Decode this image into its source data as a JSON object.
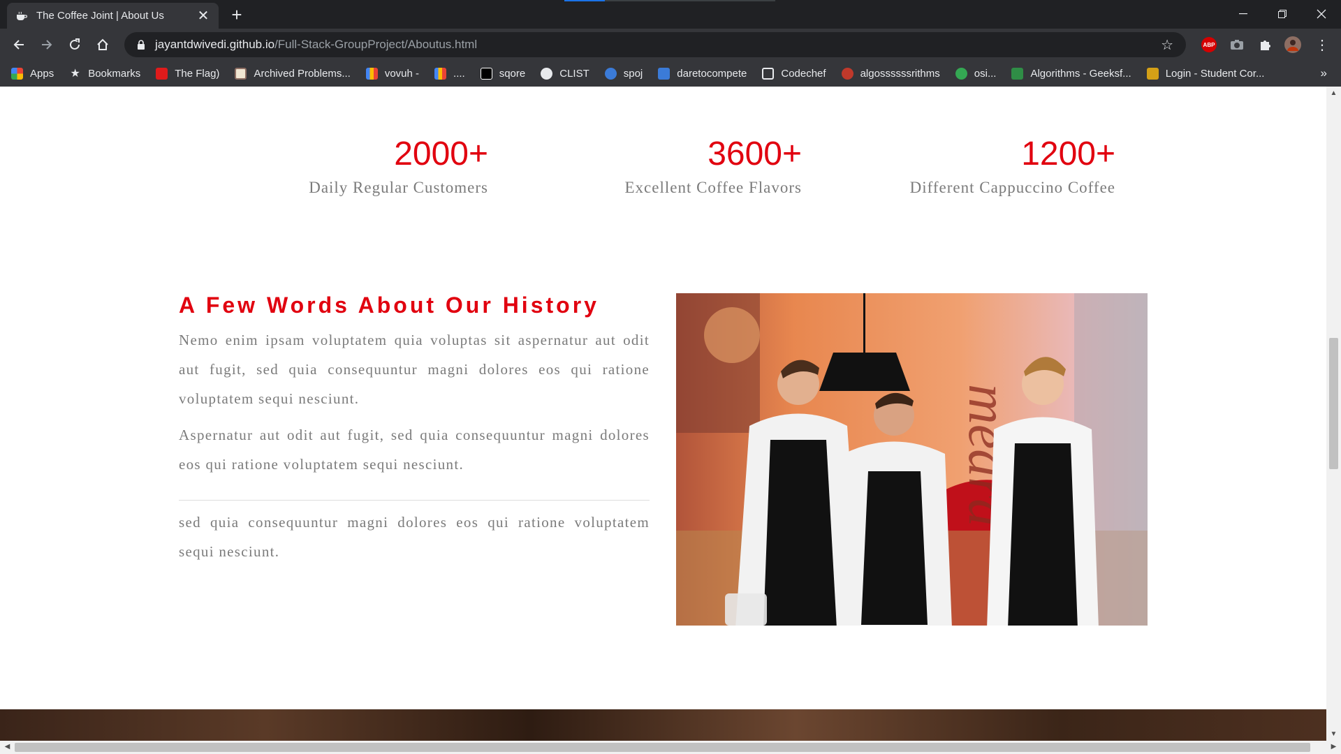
{
  "browser": {
    "tab_title": "The Coffee Joint | About Us",
    "url_host": "jayantdwivedi.github.io",
    "url_path": "/Full-Stack-GroupProject/Aboutus.html",
    "extension_abp_label": "ABP"
  },
  "bookmarks": [
    {
      "label": "Apps",
      "color": "#ea4335"
    },
    {
      "label": "Bookmarks",
      "color": "#e8eaed"
    },
    {
      "label": "The Flag)",
      "color": "#e01b1b"
    },
    {
      "label": "Archived Problems...",
      "color": "#f0e6d2"
    },
    {
      "label": "vovuh -",
      "color": "#fbbc05"
    },
    {
      "label": "....",
      "color": "#4285f4"
    },
    {
      "label": "sqore",
      "color": "#000000"
    },
    {
      "label": "CLIST",
      "color": "#e8eaed"
    },
    {
      "label": "spoj",
      "color": "#3b7bd8"
    },
    {
      "label": "daretocompete",
      "color": "#3b7bd8"
    },
    {
      "label": "Codechef",
      "color": "#e8eaed"
    },
    {
      "label": "algossssssrithms",
      "color": "#c0392b"
    },
    {
      "label": "osi...",
      "color": "#34a853"
    },
    {
      "label": "Algorithms - Geeksf...",
      "color": "#2f8d46"
    },
    {
      "label": "Login - Student Cor...",
      "color": "#d4a017"
    }
  ],
  "stats": [
    {
      "number": "2000+",
      "label": "Daily Regular Customers"
    },
    {
      "number": "3600+",
      "label": "Excellent Coffee Flavors"
    },
    {
      "number": "1200+",
      "label": "Different Cappuccino Coffee"
    }
  ],
  "history": {
    "title": "A Few Words About Our History",
    "paragraph1": "Nemo enim ipsam voluptatem quia voluptas sit aspernatur aut odit aut fugit, sed quia consequuntur magni dolores eos qui ratione voluptatem sequi nesciunt.",
    "paragraph2": "Aspernatur aut odit aut fugit, sed quia consequuntur magni dolores eos qui ratione voluptatem sequi nesciunt.",
    "paragraph3": "sed quia consequuntur magni dolores eos qui ratione voluptatem sequi nesciunt."
  },
  "colors": {
    "accent": "#e1000f",
    "body_text": "#7b7b7b"
  }
}
